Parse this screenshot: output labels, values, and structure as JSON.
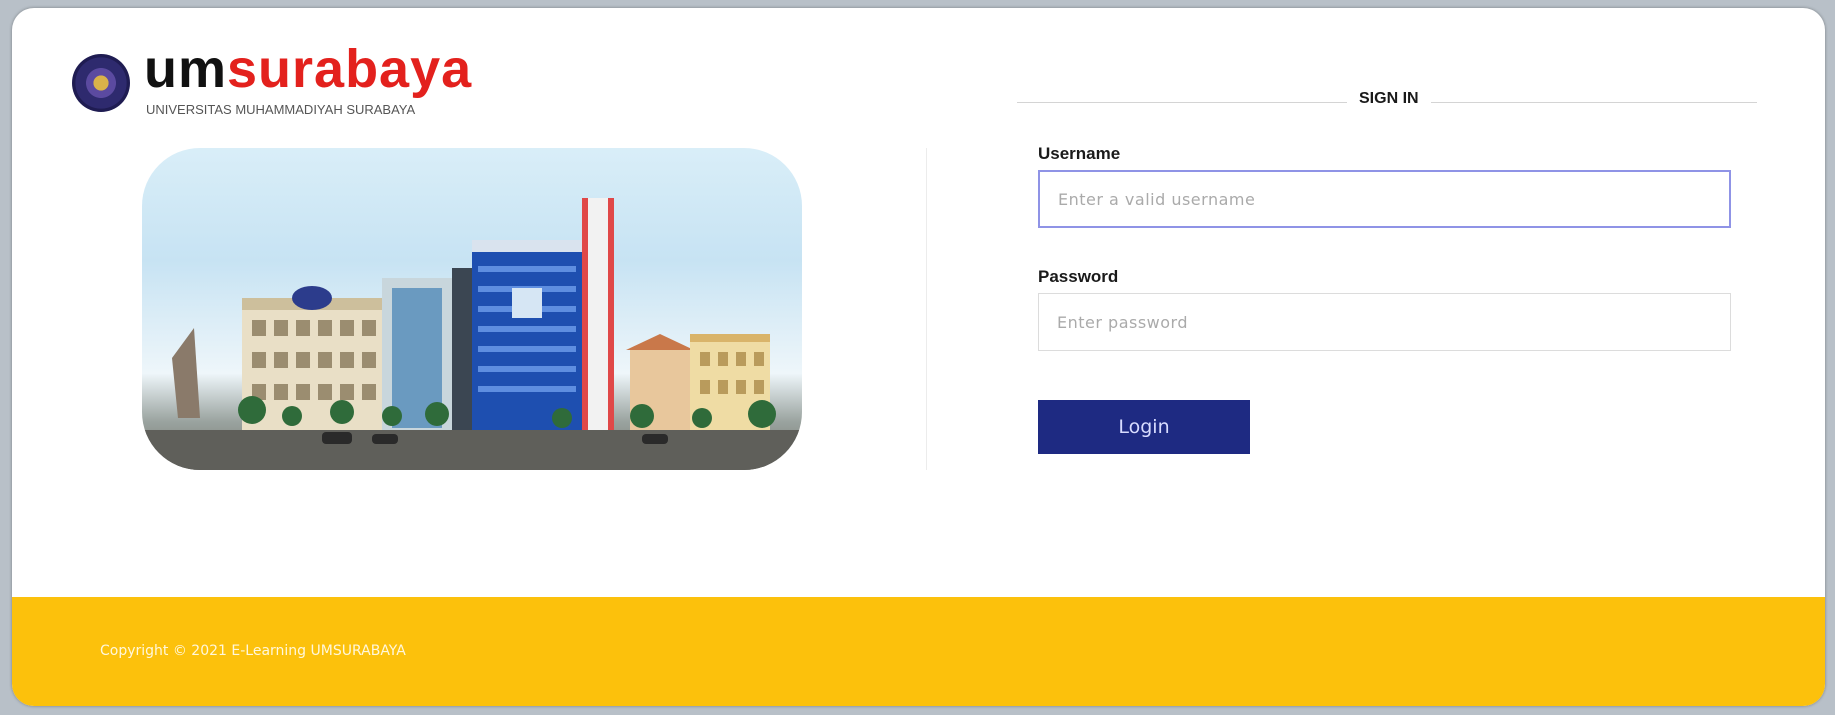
{
  "logo": {
    "um": "um",
    "surabaya": "surabaya",
    "subtitle": "UNIVERSITAS MUHAMMADIYAH SURABAYA",
    "emblem_icon": "university-emblem-icon",
    "colors": {
      "um": "#111111",
      "surabaya": "#e3211d"
    }
  },
  "campus_image": {
    "description_icon": "campus-building-photo"
  },
  "signin": {
    "title": "SIGN IN",
    "username_label": "Username",
    "username_placeholder": "Enter a valid username",
    "username_value": "",
    "password_label": "Password",
    "password_placeholder": "Enter password",
    "password_value": "",
    "login_label": "Login"
  },
  "footer": {
    "copyright": "Copyright © 2021 E-Learning UMSURABAYA"
  },
  "colors": {
    "accent": "#1e2a82",
    "footer": "#fcc10c",
    "focus_border": "#8f93e6"
  }
}
